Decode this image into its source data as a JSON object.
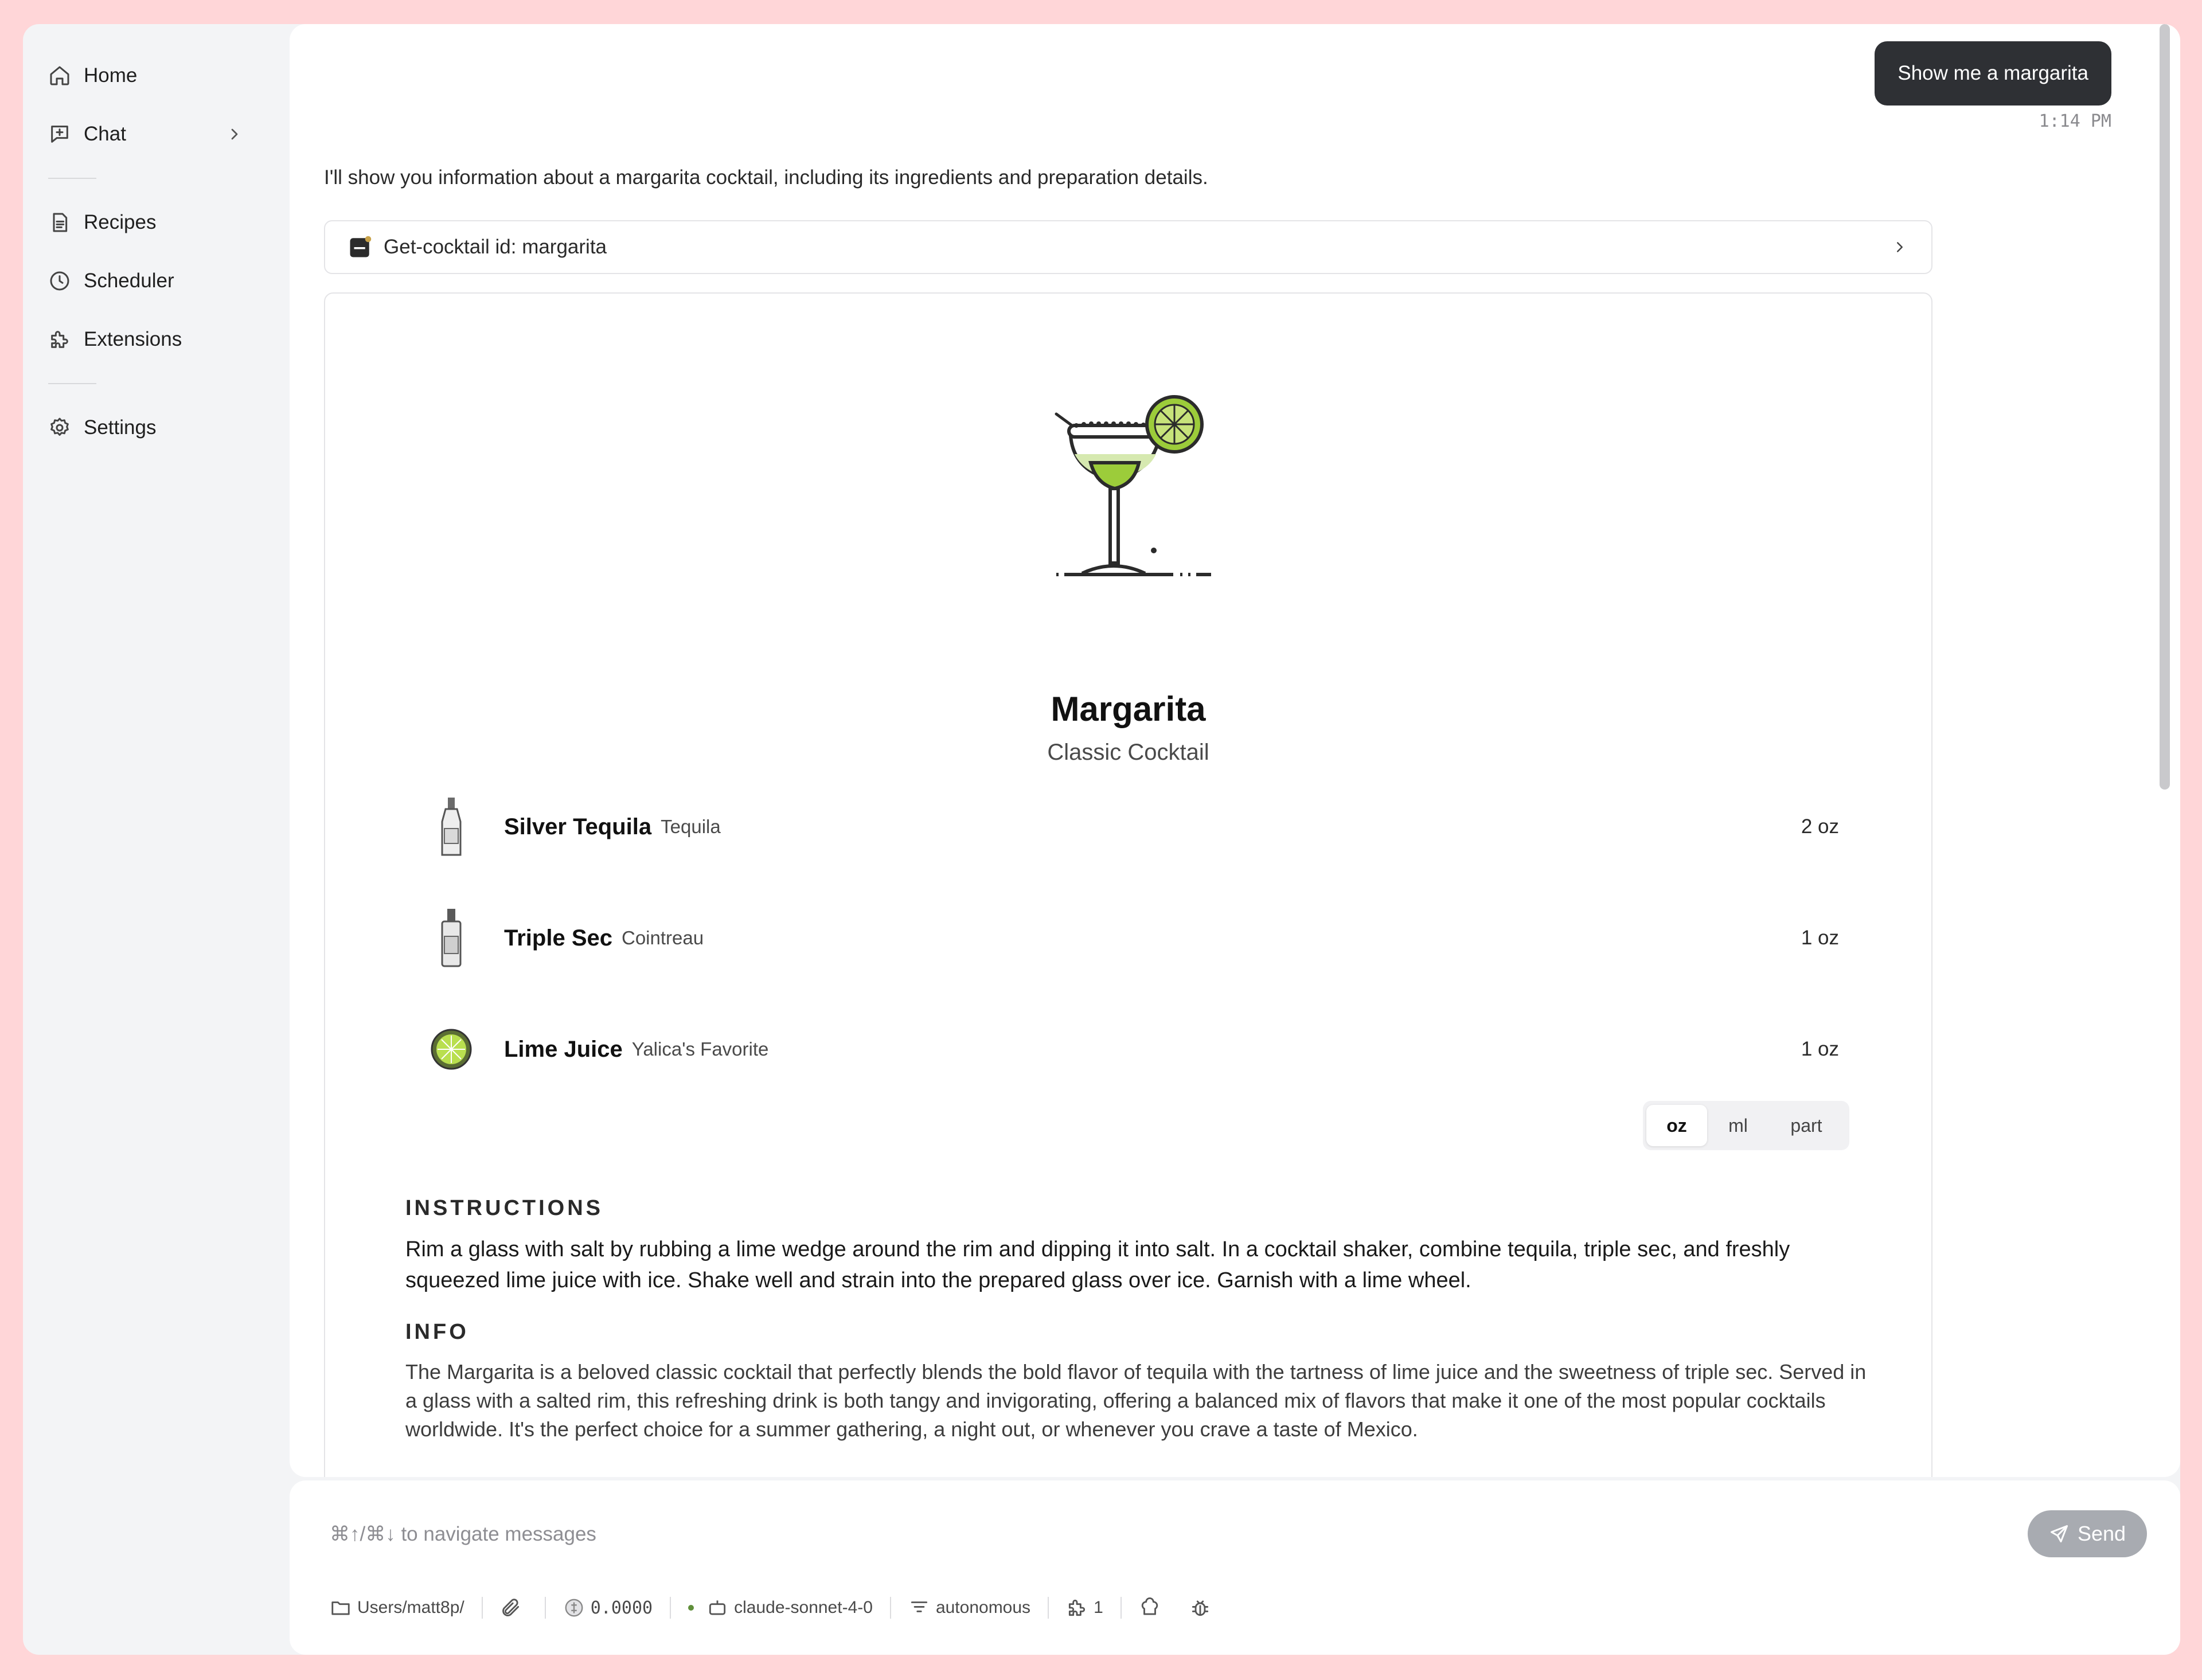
{
  "sidebar": {
    "items": [
      {
        "label": "Home",
        "icon": "home-icon"
      },
      {
        "label": "Chat",
        "icon": "chat-plus-icon"
      },
      {
        "label": "Recipes",
        "icon": "document-icon"
      },
      {
        "label": "Scheduler",
        "icon": "clock-icon"
      },
      {
        "label": "Extensions",
        "icon": "puzzle-icon"
      },
      {
        "label": "Settings",
        "icon": "gear-icon"
      }
    ]
  },
  "conversation": {
    "user_message": "Show me a margarita",
    "user_time": "1:14 PM",
    "assistant_text": "I'll show you information about a margarita cocktail, including its ingredients and preparation details.",
    "tool_call": "Get-cocktail id: margarita"
  },
  "cocktail": {
    "name": "Margarita",
    "category": "Classic Cocktail",
    "ingredients": [
      {
        "name": "Silver Tequila",
        "brand": "Tequila",
        "amount": "2 oz",
        "icon": "tequila-bottle-icon"
      },
      {
        "name": "Triple Sec",
        "brand": "Cointreau",
        "amount": "1 oz",
        "icon": "liqueur-bottle-icon"
      },
      {
        "name": "Lime Juice",
        "brand": "Yalica's Favorite",
        "amount": "1 oz",
        "icon": "lime-icon"
      }
    ],
    "units": [
      "oz",
      "ml",
      "part"
    ],
    "selected_unit": "oz",
    "instructions_heading": "INSTRUCTIONS",
    "instructions": "Rim a glass with salt by rubbing a lime wedge around the rim and dipping it into salt. In a cocktail shaker, combine tequila, triple sec, and freshly squeezed lime juice with ice. Shake well and strain into the prepared glass over ice. Garnish with a lime wheel.",
    "info_heading": "INFO",
    "info": "The Margarita is a beloved classic cocktail that perfectly blends the bold flavor of tequila with the tartness of lime juice and the sweetness of triple sec. Served in a glass with a salted rim, this refreshing drink is both tangy and invigorating, offering a balanced mix of flavors that make it one of the most popular cocktails worldwide. It's the perfect choice for a summer gathering, a night out, or whenever you crave a taste of Mexico."
  },
  "input": {
    "placeholder": "⌘↑/⌘↓ to navigate messages",
    "send_label": "Send"
  },
  "status_bar": {
    "directory": "Users/matt8p/",
    "cost": "0.0000",
    "model": "claude-sonnet-4-0",
    "mode": "autonomous",
    "extensions_count": "1"
  },
  "colors": {
    "background": "#ffd6d8",
    "user_bubble": "#2e3034",
    "send_button": "#a8abb1",
    "lime_green": "#9ccc3a"
  }
}
